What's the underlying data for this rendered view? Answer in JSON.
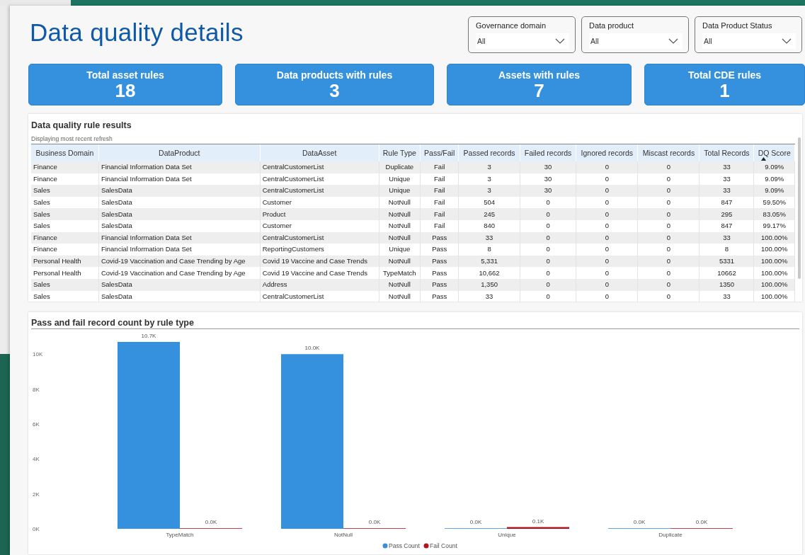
{
  "page_title": "Data quality details",
  "slicers": [
    {
      "label": "Governance domain",
      "value": "All"
    },
    {
      "label": "Data product",
      "value": "All"
    },
    {
      "label": "Data Product Status",
      "value": "All"
    }
  ],
  "kpis": [
    {
      "label": "Total asset rules",
      "value": "18"
    },
    {
      "label": "Data products with rules",
      "value": "3"
    },
    {
      "label": "Assets with rules",
      "value": "7"
    },
    {
      "label": "Total CDE rules",
      "value": "1"
    }
  ],
  "results_table": {
    "title": "Data quality rule results",
    "subtitle": "Displaying most recent refresh",
    "columns": [
      {
        "label": "Business Domain",
        "sorted": false
      },
      {
        "label": "DataProduct",
        "sorted": false
      },
      {
        "label": "DataAsset",
        "sorted": false
      },
      {
        "label": "Rule Type",
        "sorted": false
      },
      {
        "label": "Pass/Fail",
        "sorted": false
      },
      {
        "label": "Passed records",
        "sorted": false
      },
      {
        "label": "Failed records",
        "sorted": false
      },
      {
        "label": "Ignored records",
        "sorted": false
      },
      {
        "label": "Miscast records",
        "sorted": false
      },
      {
        "label": "Total Records",
        "sorted": false
      },
      {
        "label": "DQ Score",
        "sorted": true
      }
    ],
    "rows": [
      [
        "Finance",
        "Financial Information Data Set",
        "CentralCustomerList",
        "Duplicate",
        "Fail",
        "3",
        "30",
        "0",
        "0",
        "33",
        "9.09%"
      ],
      [
        "Finance",
        "Financial Information Data Set",
        "CentralCustomerList",
        "Unique",
        "Fail",
        "3",
        "30",
        "0",
        "0",
        "33",
        "9.09%"
      ],
      [
        "Sales",
        "SalesData",
        "CentralCustomerList",
        "Unique",
        "Fail",
        "3",
        "30",
        "0",
        "0",
        "33",
        "9.09%"
      ],
      [
        "Sales",
        "SalesData",
        "Customer",
        "NotNull",
        "Fail",
        "504",
        "0",
        "0",
        "0",
        "847",
        "59.50%"
      ],
      [
        "Sales",
        "SalesData",
        "Product",
        "NotNull",
        "Fail",
        "245",
        "0",
        "0",
        "0",
        "295",
        "83.05%"
      ],
      [
        "Sales",
        "SalesData",
        "Customer",
        "NotNull",
        "Fail",
        "840",
        "0",
        "0",
        "0",
        "847",
        "99.17%"
      ],
      [
        "Finance",
        "Financial Information Data Set",
        "CentralCustomerList",
        "NotNull",
        "Pass",
        "33",
        "0",
        "0",
        "0",
        "33",
        "100.00%"
      ],
      [
        "Finance",
        "Financial Information Data Set",
        "ReportingCustomers",
        "Unique",
        "Pass",
        "8",
        "0",
        "0",
        "0",
        "8",
        "100.00%"
      ],
      [
        "Personal Health",
        "Covid-19 Vaccination and Case Trending by Age",
        "Covid 19 Vaccine and Case Trends",
        "NotNull",
        "Pass",
        "5,331",
        "0",
        "0",
        "0",
        "5331",
        "100.00%"
      ],
      [
        "Personal Health",
        "Covid-19 Vaccination and Case Trending by Age",
        "Covid 19 Vaccine and Case Trends",
        "TypeMatch",
        "Pass",
        "10,662",
        "0",
        "0",
        "0",
        "10662",
        "100.00%"
      ],
      [
        "Sales",
        "SalesData",
        "Address",
        "NotNull",
        "Pass",
        "1,350",
        "0",
        "0",
        "0",
        "1350",
        "100.00%"
      ],
      [
        "Sales",
        "SalesData",
        "CentralCustomerList",
        "NotNull",
        "Pass",
        "33",
        "0",
        "0",
        "0",
        "33",
        "100.00%"
      ]
    ]
  },
  "chart": {
    "chart_data": {
      "type": "bar",
      "title": "Pass and fail record count by rule type",
      "categories": [
        "TypeMatch",
        "NotNull",
        "Unique",
        "Duplicate"
      ],
      "series": [
        {
          "name": "Pass Count",
          "color": "#3591de",
          "values": [
            10700,
            10000,
            0,
            0
          ]
        },
        {
          "name": "Fail Count",
          "color": "#b0141e",
          "values": [
            0,
            0,
            100,
            0
          ]
        }
      ],
      "legend": true,
      "ylim": [
        0,
        10700
      ],
      "yticks": [
        {
          "value": 0,
          "label": "0K"
        },
        {
          "value": 2000,
          "label": "2K"
        },
        {
          "value": 4000,
          "label": "4K"
        },
        {
          "value": 6000,
          "label": "6K"
        },
        {
          "value": 8000,
          "label": "8K"
        },
        {
          "value": 10000,
          "label": "10K"
        }
      ],
      "value_labels": [
        [
          "10.7K",
          "10.0K",
          "0.0K",
          "0.0K"
        ],
        [
          "0.0K",
          "0.0K",
          "0.1K",
          "0.0K"
        ]
      ]
    }
  }
}
